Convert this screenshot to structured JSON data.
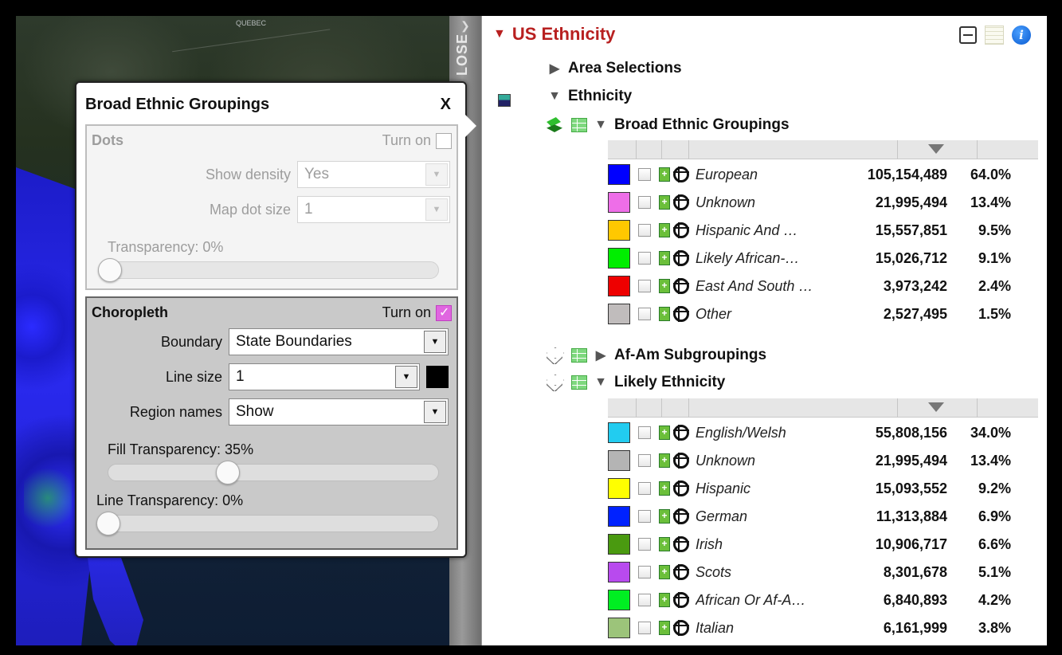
{
  "map": {
    "labels": [
      "QUEBEC"
    ]
  },
  "close_strip": {
    "label": "LOSE"
  },
  "popup": {
    "title": "Broad Ethnic Groupings",
    "close": "X",
    "dots": {
      "heading": "Dots",
      "turn_on": "Turn on",
      "turn_on_checked": false,
      "show_density_label": "Show density",
      "show_density_value": "Yes",
      "map_dot_size_label": "Map dot size",
      "map_dot_size_value": "1",
      "transparency_label": "Transparency:  0%",
      "transparency_value": 0
    },
    "choropleth": {
      "heading": "Choropleth",
      "turn_on": "Turn on",
      "turn_on_checked": true,
      "boundary_label": "Boundary",
      "boundary_value": "State Boundaries",
      "line_size_label": "Line size",
      "line_size_value": "1",
      "line_color": "#000000",
      "region_names_label": "Region names",
      "region_names_value": "Show",
      "fill_transparency_label": "Fill Transparency:  35%",
      "fill_transparency_value": 35,
      "line_transparency_label": "Line Transparency:  0%",
      "line_transparency_value": 0
    }
  },
  "panel": {
    "title": "US Ethnicity",
    "area_selections": "Area Selections",
    "ethnicity": "Ethnicity",
    "broad": {
      "title": "Broad Ethnic Groupings",
      "rows": [
        {
          "color": "#0000ff",
          "name": "European",
          "value": "105,154,489",
          "pct": "64.0%"
        },
        {
          "color": "#ee6ee8",
          "name": "Unknown",
          "value": "21,995,494",
          "pct": "13.4%"
        },
        {
          "color": "#ffc800",
          "name": "Hispanic And …",
          "value": "15,557,851",
          "pct": "9.5%"
        },
        {
          "color": "#00ee00",
          "name": "Likely African-…",
          "value": "15,026,712",
          "pct": "9.1%"
        },
        {
          "color": "#ee0000",
          "name": "East And South …",
          "value": "3,973,242",
          "pct": "2.4%"
        },
        {
          "color": "#c0bcbc",
          "name": "Other",
          "value": "2,527,495",
          "pct": "1.5%"
        }
      ]
    },
    "afam": "Af-Am Subgroupings",
    "likely": {
      "title": "Likely Ethnicity",
      "rows": [
        {
          "color": "#22ccf0",
          "name": "English/Welsh",
          "value": "55,808,156",
          "pct": "34.0%"
        },
        {
          "color": "#b4b4b4",
          "name": "Unknown",
          "value": "21,995,494",
          "pct": "13.4%"
        },
        {
          "color": "#ffff00",
          "name": "Hispanic",
          "value": "15,093,552",
          "pct": "9.2%"
        },
        {
          "color": "#0022ff",
          "name": "German",
          "value": "11,313,884",
          "pct": "6.9%"
        },
        {
          "color": "#4a9a10",
          "name": "Irish",
          "value": "10,906,717",
          "pct": "6.6%"
        },
        {
          "color": "#b84aee",
          "name": "Scots",
          "value": "8,301,678",
          "pct": "5.1%"
        },
        {
          "color": "#00ee22",
          "name": "African Or Af-A…",
          "value": "6,840,893",
          "pct": "4.2%"
        },
        {
          "color": "#9cc47a",
          "name": "Italian",
          "value": "6,161,999",
          "pct": "3.8%"
        }
      ]
    }
  }
}
